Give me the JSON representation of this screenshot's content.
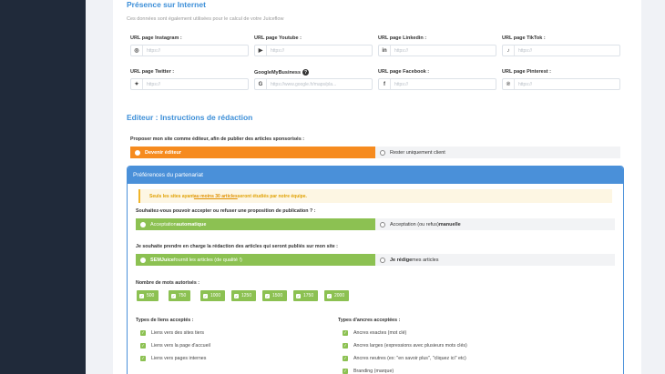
{
  "presence": {
    "title": "Présence sur Internet",
    "subtitle": "Ces données sont également utilisées pour le calcul de votre Juiceflow",
    "fields": [
      {
        "label": "URL page Instagram :",
        "placeholder": "https://",
        "icon": "instagram-icon",
        "glyph": "◎"
      },
      {
        "label": "URL page Youtube :",
        "placeholder": "https://",
        "icon": "youtube-icon",
        "glyph": "▶"
      },
      {
        "label": "URL page Linkedin :",
        "placeholder": "https://",
        "icon": "linkedin-icon",
        "glyph": "in"
      },
      {
        "label": "URL page TikTok :",
        "placeholder": "https://",
        "icon": "tiktok-icon",
        "glyph": "♪"
      },
      {
        "label": "URL page Twitter :",
        "placeholder": "https://",
        "icon": "twitter-icon",
        "glyph": "✦"
      },
      {
        "label": "GoogleMyBusiness",
        "placeholder": "https://www.google.fr/maps/pla...",
        "icon": "google-icon",
        "glyph": "G",
        "help": "?"
      },
      {
        "label": "URL page Facebook :",
        "placeholder": "https://",
        "icon": "facebook-icon",
        "glyph": "f"
      },
      {
        "label": "URL page Pinterest :",
        "placeholder": "https://",
        "icon": "pinterest-icon",
        "glyph": "℗"
      }
    ]
  },
  "editor": {
    "title": "Editeur : Instructions de rédaction",
    "question": "Proposer mon site comme éditeur, afin de publier des articles sponsorisés :",
    "option_editor": "Devenir éditeur",
    "option_client": "Rester uniquement client"
  },
  "prefs": {
    "title": "Préférences du partenariat",
    "note_pre": "Seuls les sites ayant ",
    "note_link": "au moins 30 articles",
    "note_post": " seront étudiés par notre équipe.",
    "q1": "Souhaitez-vous pouvoir accepter ou refuser une proposition de publication ? :",
    "q1_auto_prefix": "Acceptation ",
    "q1_auto_bold": "automatique",
    "q1_manual_prefix": "Acceptation (ou refus) ",
    "q1_manual_bold": "manuelle",
    "q2": "Je souhaite prendre en charge la rédaction des articles qui seront publiés sur mon site :",
    "q2_semjuice_bold": "SEMJuice",
    "q2_semjuice_rest": " fournit les articles (de qualité !)",
    "q2_me_bold": "Je rédige",
    "q2_me_rest": " mes articles",
    "words_label": "Nombre de mots autorisés :",
    "words": [
      "500",
      "750",
      "1000",
      "1250",
      "1500",
      "1750",
      "2000"
    ],
    "links_title": "Types de liens acceptés :",
    "links": [
      "Liens vers des sites tiers",
      "Liens vers la page d'accueil",
      "Liens vers pages internes"
    ],
    "anchors_title": "Types d'ancres acceptées :",
    "anchors": [
      "Ancres exactes (mot clé)",
      "Ancres larges (expressions avec plusieurs mots clés)",
      "Ancres neutres (ex: \"en savoir plus\", \"cliquez ici\" etc)",
      "Branding (marque)"
    ]
  },
  "colors": {
    "accent": "#3d8fd8",
    "orange": "#f68b1f",
    "green": "#8cc152"
  }
}
